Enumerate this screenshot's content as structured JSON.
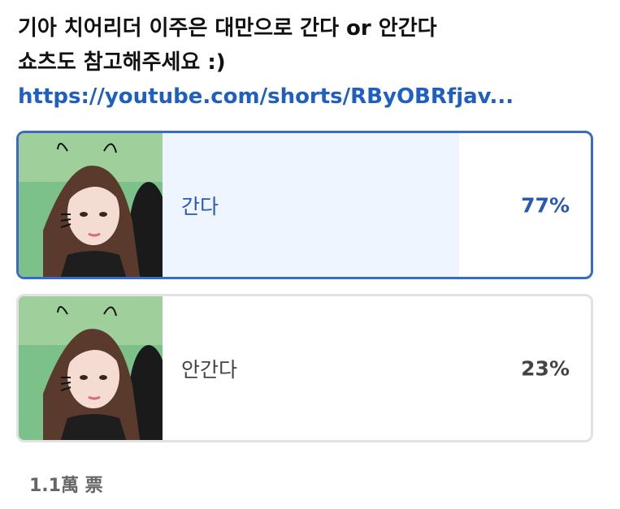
{
  "post": {
    "line1": "기아 치어리더 이주은 대만으로 간다 or 안간다",
    "line2": "쇼츠도 참고해주세요 :)",
    "link": "https://youtube.com/shorts/RByOBRfjav..."
  },
  "poll": {
    "options": [
      {
        "label": "간다",
        "percent": "77%",
        "fill_fraction": 0.77,
        "selected": true,
        "thumbnail_icon": "cheerleader-photo-icon"
      },
      {
        "label": "안간다",
        "percent": "23%",
        "fill_fraction": 0.23,
        "selected": false,
        "thumbnail_icon": "cheerleader-photo-icon"
      }
    ],
    "total_votes": "1.1萬 票"
  },
  "colors": {
    "accent": "#3a6bc4",
    "selected_fill": "#eef5fe",
    "unselected_fill": "#e6e6e6",
    "link": "#1f5fbf"
  }
}
